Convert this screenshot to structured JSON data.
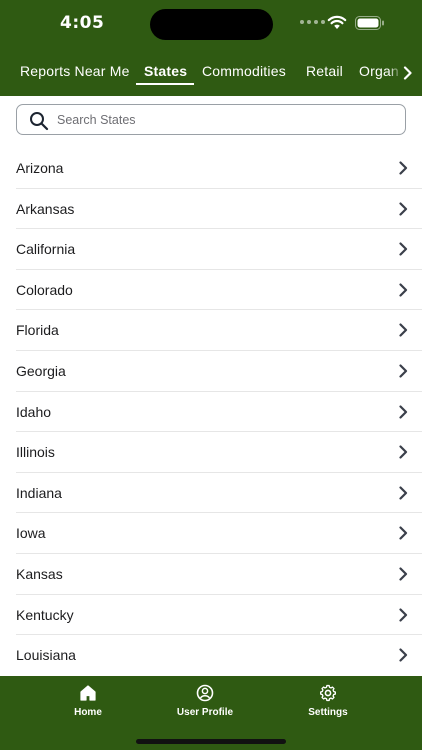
{
  "status_bar": {
    "time": "4:05"
  },
  "tabs": [
    {
      "label": "Reports Near Me",
      "active": false
    },
    {
      "label": "States",
      "active": true
    },
    {
      "label": "Commodities",
      "active": false
    },
    {
      "label": "Retail",
      "active": false
    },
    {
      "label": "Organ",
      "active": false
    }
  ],
  "search": {
    "placeholder": "Search States",
    "value": ""
  },
  "states": [
    "Arizona",
    "Arkansas",
    "California",
    "Colorado",
    "Florida",
    "Georgia",
    "Idaho",
    "Illinois",
    "Indiana",
    "Iowa",
    "Kansas",
    "Kentucky",
    "Louisiana"
  ],
  "bottom_nav": [
    {
      "label": "Home",
      "icon": "home-icon",
      "active": true
    },
    {
      "label": "User Profile",
      "icon": "user-profile-icon",
      "active": false
    },
    {
      "label": "Settings",
      "icon": "gear-icon",
      "active": false
    }
  ],
  "colors": {
    "brand_green": "#2f5a12",
    "chevron": "#3a3f4a"
  }
}
